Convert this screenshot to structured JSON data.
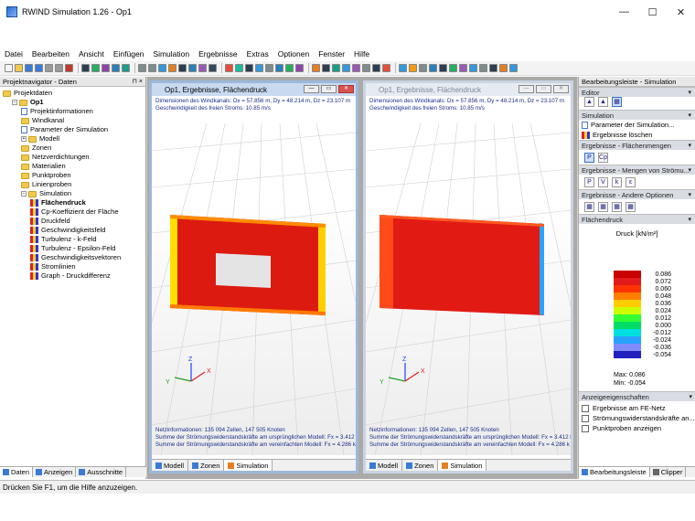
{
  "app": {
    "title": "RWIND Simulation 1.26 - Op1"
  },
  "window_controls": {
    "minimize": "—",
    "maximize": "☐",
    "close": "✕"
  },
  "menu": [
    "Datei",
    "Bearbeiten",
    "Ansicht",
    "Einfügen",
    "Simulation",
    "Ergebnisse",
    "Extras",
    "Optionen",
    "Fenster",
    "Hilfe"
  ],
  "navigator": {
    "title": "Projektnavigator - Daten",
    "header_buttons": "⊓ ×",
    "items": [
      {
        "label": "Projektdaten",
        "indent": 0,
        "type": "folder",
        "toggle": ""
      },
      {
        "label": "Op1",
        "indent": 1,
        "type": "folder",
        "toggle": "−",
        "bold": true
      },
      {
        "label": "Projektinformationen",
        "indent": 2,
        "type": "doc"
      },
      {
        "label": "Windkanal",
        "indent": 2,
        "type": "folder"
      },
      {
        "label": "Parameter der Simulation",
        "indent": 2,
        "type": "doc"
      },
      {
        "label": "Modell",
        "indent": 2,
        "type": "folder",
        "toggle": "+"
      },
      {
        "label": "Zonen",
        "indent": 2,
        "type": "folder"
      },
      {
        "label": "Netzverdichtungen",
        "indent": 2,
        "type": "folder"
      },
      {
        "label": "Materialien",
        "indent": 2,
        "type": "folder"
      },
      {
        "label": "Punktproben",
        "indent": 2,
        "type": "folder"
      },
      {
        "label": "Linienproben",
        "indent": 2,
        "type": "folder"
      },
      {
        "label": "Simulation",
        "indent": 2,
        "type": "folder",
        "toggle": "−"
      },
      {
        "label": "Flächendruck",
        "indent": 3,
        "type": "res",
        "bold": true
      },
      {
        "label": "Cp-Koeffizient der Fläche",
        "indent": 3,
        "type": "res"
      },
      {
        "label": "Druckfeld",
        "indent": 3,
        "type": "res"
      },
      {
        "label": "Geschwindigkeitsfeld",
        "indent": 3,
        "type": "res"
      },
      {
        "label": "Turbulenz - k-Feld",
        "indent": 3,
        "type": "res"
      },
      {
        "label": "Turbulenz - Epsilon-Feld",
        "indent": 3,
        "type": "res"
      },
      {
        "label": "Geschwindigkeitsvektoren",
        "indent": 3,
        "type": "res"
      },
      {
        "label": "Stromlinien",
        "indent": 3,
        "type": "res"
      },
      {
        "label": "Graph - Druckdifferenz",
        "indent": 3,
        "type": "res"
      }
    ],
    "tabs": [
      "Daten",
      "Anzeigen",
      "Ausschnitte"
    ]
  },
  "windows": [
    {
      "title": "Op1, Ergebnisse, Flächendruck",
      "active": true,
      "info_top": [
        "Dimensionen des Windkanals: Dx = 57.856 m, Dy = 48.214 m, Dz = 23.107 m",
        "Geschwindigkeit des freien Stroms: 10.85 m/s"
      ],
      "info_bottom": [
        "Netzinformationen: 135 094 Zellen, 147 505 Knoten",
        "Summe der Strömungswiderstandskräfte am ursprünglichen Modell: Fx = 3.412 k",
        "Summe der Strömungswiderstandskräfte am vereinfachten Modell: Fx = 4.286 k"
      ],
      "tabs": [
        "Modell",
        "Zonen",
        "Simulation"
      ]
    },
    {
      "title": "Op1, Ergebnisse, Flächendruck",
      "active": false,
      "info_top": [
        "Dimensionen des Windkanals: Dx = 57.856 m, Dy = 48.214 m, Dz = 23.107 m",
        "Geschwindigkeit des freien Stroms: 10.85 m/s"
      ],
      "info_bottom": [
        "Netzinformationen: 135 094 Zellen, 147 505 Knoten",
        "Summe der Strömungswiderstandskräfte am ursprünglichen Modell: Fx = 3.412 k",
        "Summe der Strömungswiderstandskräfte am vereinfachten Modell: Fx = 4.286 k"
      ],
      "tabs": [
        "Modell",
        "Zonen",
        "Simulation"
      ]
    }
  ],
  "axes": {
    "x": "X",
    "y": "Y",
    "z": "Z"
  },
  "rpanel": {
    "title": "Bearbeitungsleiste - Simulation",
    "sections": {
      "editor": "Editor",
      "simulation": "Simulation",
      "flaechenmengen": "Ergebnisse - Flächenmengen",
      "stroemung": "Ergebnisse - Mengen von Strömu...",
      "andere": "Ergebnisse - Andere Optionen",
      "flaechendruck": "Flächendruck",
      "anzeige": "Anzeigeeigenschaften"
    },
    "sim_items": [
      "Parameter der Simulation...",
      "Ergebnisse löschen"
    ],
    "fm_buttons": [
      "P",
      "Cp"
    ],
    "stroem_buttons": [
      "P",
      "V",
      "k",
      "ε"
    ],
    "legend_title": "Druck [kN/m²]",
    "legend": [
      {
        "v": "0.086",
        "c": "#c80000"
      },
      {
        "v": "0.072",
        "c": "#e21a1a"
      },
      {
        "v": "0.060",
        "c": "#ff3300"
      },
      {
        "v": "0.048",
        "c": "#ff8000"
      },
      {
        "v": "0.036",
        "c": "#ffcc00"
      },
      {
        "v": "0.024",
        "c": "#ccff00"
      },
      {
        "v": "0.012",
        "c": "#33ff33"
      },
      {
        "v": "0.000",
        "c": "#00dd66"
      },
      {
        "v": "-0.012",
        "c": "#00e0e0"
      },
      {
        "v": "-0.024",
        "c": "#2aa3ff"
      },
      {
        "v": "-0.036",
        "c": "#7f8cff"
      },
      {
        "v": "-0.054",
        "c": "#2020c0"
      }
    ],
    "max_label": "Max:",
    "max_value": "0.086",
    "min_label": "Min:",
    "min_value": "-0.054",
    "checkboxes": [
      "Ergebnisse am FE-Netz",
      "Strömungswiderstandskräfte an...",
      "Punktproben anzeigen"
    ],
    "tabs": [
      "Bearbeitungsleiste",
      "Clipper"
    ]
  },
  "status": "Drücken Sie F1, um die Hilfe anzuzeigen."
}
